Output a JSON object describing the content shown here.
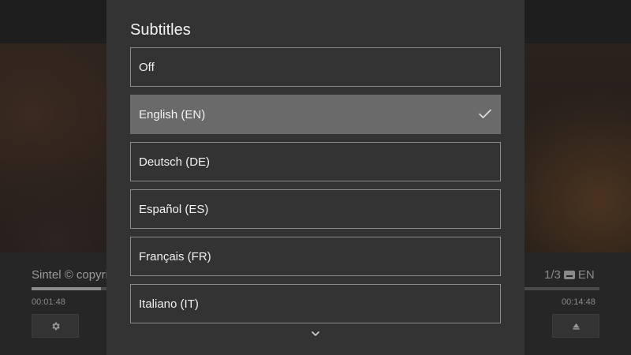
{
  "player": {
    "title": "Sintel © copyright",
    "subtitle_status": "1/3",
    "subtitle_lang": "EN",
    "time_current": "00:01:48",
    "time_total": "00:14:48",
    "progress_fraction": 0.122
  },
  "modal": {
    "title": "Subtitles",
    "options": [
      {
        "label": "Off",
        "selected": false
      },
      {
        "label": "English (EN)",
        "selected": true
      },
      {
        "label": "Deutsch (DE)",
        "selected": false
      },
      {
        "label": "Español (ES)",
        "selected": false
      },
      {
        "label": "Français (FR)",
        "selected": false
      },
      {
        "label": "Italiano (IT)",
        "selected": false
      }
    ],
    "scroll_icon": "chevron-down-icon",
    "check_icon": "checkmark-icon"
  },
  "colors": {
    "modal_bg": "#333333",
    "selected_bg": "#6a6a6a",
    "option_border": "#8a8a8a",
    "text": "#f2f2f2"
  }
}
